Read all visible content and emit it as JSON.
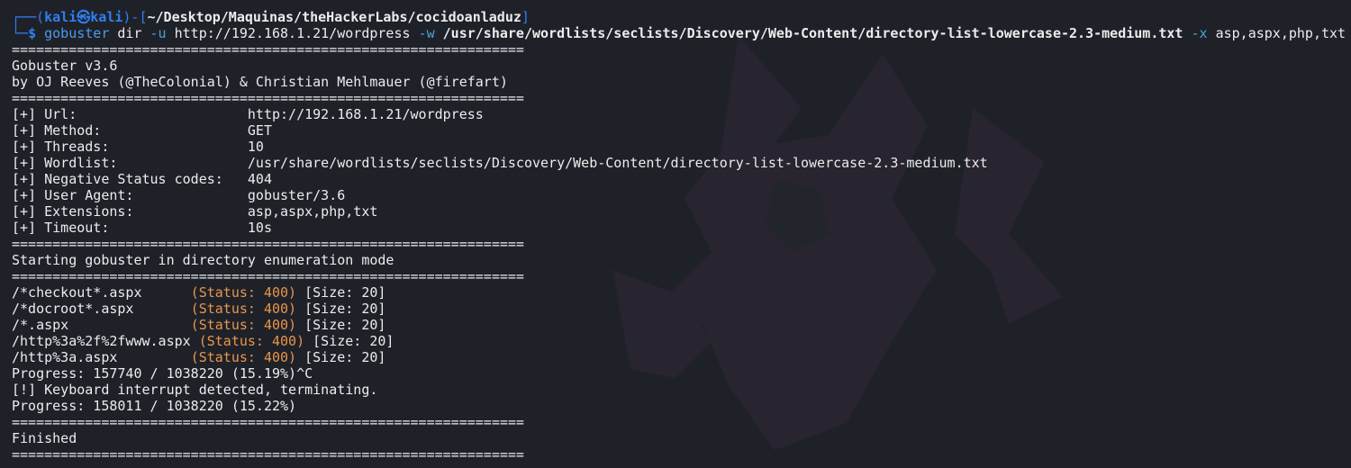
{
  "prompt": {
    "corner_top": "┌──(",
    "user": "kali",
    "at": "㉿",
    "host": "kali",
    "mid": ")-[",
    "cwd": "~/Desktop/Maquinas/theHackerLabs/cocidoanladuz",
    "close": "]",
    "corner_bottom": "└─",
    "dollar": "$"
  },
  "command": {
    "program": "gobuster",
    "subcommand": "dir",
    "flag_u": "-u",
    "url": "http://192.168.1.21/wordpress",
    "flag_w": "-w",
    "wordlist": "/usr/share/wordlists/seclists/Discovery/Web-Content/directory-list-lowercase-2.3-medium.txt",
    "flag_x": "-x",
    "extensions": "asp,aspx,php,txt"
  },
  "separator": "===============================================================",
  "banner": {
    "version": "Gobuster v3.6",
    "authors": "by OJ Reeves (@TheColonial) & Christian Mehlmauer (@firefart)"
  },
  "config": [
    {
      "key": "[+] Url:                     ",
      "value": "http://192.168.1.21/wordpress"
    },
    {
      "key": "[+] Method:                  ",
      "value": "GET"
    },
    {
      "key": "[+] Threads:                 ",
      "value": "10"
    },
    {
      "key": "[+] Wordlist:                ",
      "value": "/usr/share/wordlists/seclists/Discovery/Web-Content/directory-list-lowercase-2.3-medium.txt"
    },
    {
      "key": "[+] Negative Status codes:   ",
      "value": "404"
    },
    {
      "key": "[+] User Agent:              ",
      "value": "gobuster/3.6"
    },
    {
      "key": "[+] Extensions:              ",
      "value": "asp,aspx,php,txt"
    },
    {
      "key": "[+] Timeout:                 ",
      "value": "10s"
    }
  ],
  "mode_line": "Starting gobuster in directory enumeration mode",
  "results": [
    {
      "path": "/*checkout*.aspx      ",
      "status": "(Status: 400)",
      "size": " [Size: 20]"
    },
    {
      "path": "/*docroot*.aspx       ",
      "status": "(Status: 400)",
      "size": " [Size: 20]"
    },
    {
      "path": "/*.aspx               ",
      "status": "(Status: 400)",
      "size": " [Size: 20]"
    },
    {
      "path": "/http%3a%2f%2fwww.aspx ",
      "status": "(Status: 400)",
      "size": " [Size: 20]"
    },
    {
      "path": "/http%3a.aspx         ",
      "status": "(Status: 400)",
      "size": " [Size: 20]"
    }
  ],
  "progress1": "Progress: 157740 / 1038220 (15.19%)^C",
  "interrupt": "[!] Keyboard interrupt detected, terminating.",
  "progress2": "Progress: 158011 / 1038220 (15.22%)",
  "finished": "Finished"
}
